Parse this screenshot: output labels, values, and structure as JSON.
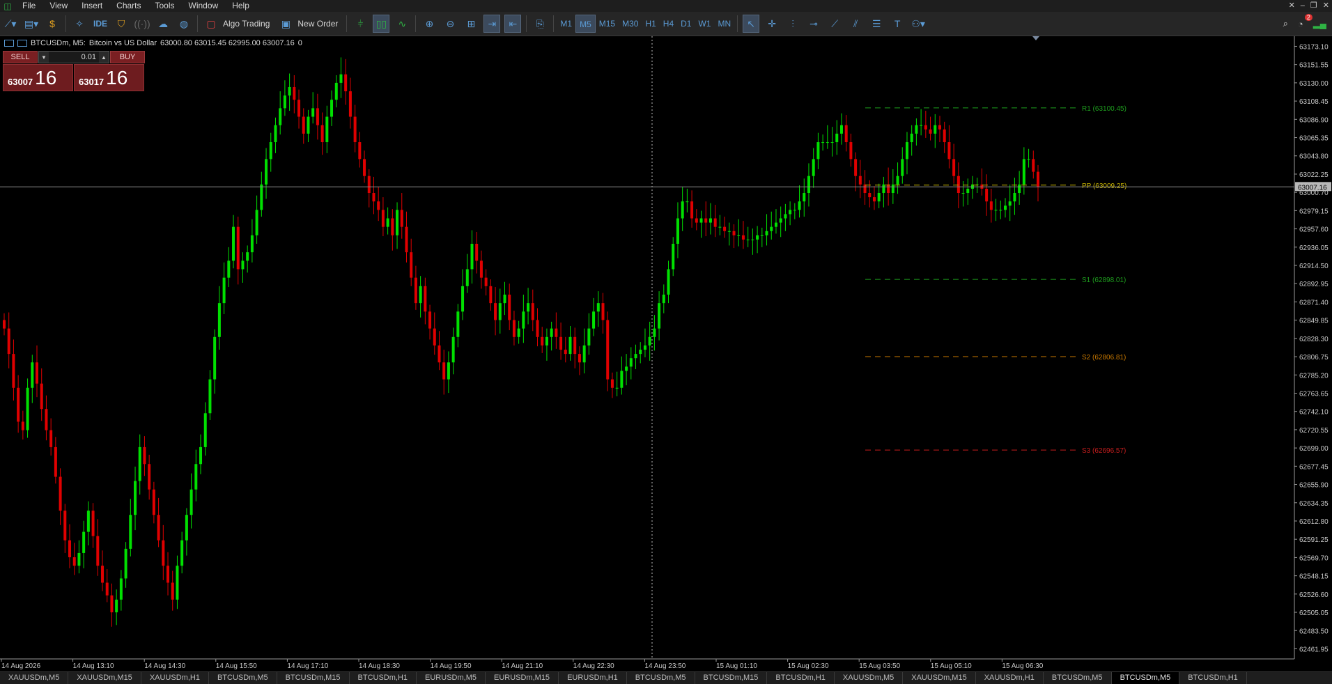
{
  "menu": {
    "items": [
      "File",
      "View",
      "Insert",
      "Charts",
      "Tools",
      "Window",
      "Help"
    ]
  },
  "toolbar": {
    "ide_label": "IDE",
    "algo_trading_label": "Algo Trading",
    "new_order_label": "New Order",
    "timeframes": [
      "M1",
      "M5",
      "M15",
      "M30",
      "H1",
      "H4",
      "D1",
      "W1",
      "MN"
    ],
    "active_timeframe": "M5",
    "notification_count": "2"
  },
  "chart_header": {
    "symbol": "BTCUSDm, M5:",
    "description": "Bitcoin vs US Dollar",
    "ohlc": "63000.80 63015.45 62995.00 63007.16",
    "volume": "0"
  },
  "trade_panel": {
    "sell_label": "SELL",
    "buy_label": "BUY",
    "lot": "0.01",
    "sell_small": "63007",
    "sell_big": "16",
    "buy_small": "63017",
    "buy_big": "16"
  },
  "chart_data": {
    "type": "candlestick",
    "symbol": "BTCUSDm",
    "timeframe": "M5",
    "ylim": [
      62450,
      63185
    ],
    "price_ticks": [
      "63173.10",
      "63151.55",
      "63130.00",
      "63108.45",
      "63086.90",
      "63065.35",
      "63043.80",
      "63022.25",
      "63000.70",
      "62979.15",
      "62957.60",
      "62936.05",
      "62914.50",
      "62892.95",
      "62871.40",
      "62849.85",
      "62828.30",
      "62806.75",
      "62785.20",
      "62763.65",
      "62742.10",
      "62720.55",
      "62699.00",
      "62677.45",
      "62655.90",
      "62634.35",
      "62612.80",
      "62591.25",
      "62569.70",
      "62548.15",
      "62526.60",
      "62505.05",
      "62483.50",
      "62461.95"
    ],
    "time_ticks": [
      "14 Aug 2026",
      "14 Aug 13:10",
      "14 Aug 14:30",
      "14 Aug 15:50",
      "14 Aug 17:10",
      "14 Aug 18:30",
      "14 Aug 19:50",
      "14 Aug 21:10",
      "14 Aug 22:30",
      "14 Aug 23:50",
      "15 Aug 01:10",
      "15 Aug 02:30",
      "15 Aug 03:50",
      "15 Aug 05:10",
      "15 Aug 06:30"
    ],
    "current_price": 63007.16,
    "current_price_label": "63007.16",
    "crosshair_time_label": "14 Aug 23:50",
    "close_series": [
      62840,
      62810,
      62770,
      62730,
      62720,
      62770,
      62800,
      62775,
      62745,
      62720,
      62700,
      62665,
      62625,
      62590,
      62570,
      62560,
      62575,
      62600,
      62625,
      62595,
      62560,
      62540,
      62525,
      62505,
      62520,
      62545,
      62580,
      62620,
      62660,
      62700,
      62680,
      62650,
      62620,
      62590,
      62560,
      62540,
      62520,
      62560,
      62590,
      62620,
      62650,
      62680,
      62700,
      62740,
      62780,
      62830,
      62870,
      62900,
      62920,
      62960,
      62910,
      62920,
      62930,
      62950,
      62980,
      63010,
      63040,
      63060,
      63080,
      63100,
      63115,
      63125,
      63110,
      63090,
      63070,
      63090,
      63100,
      63080,
      63060,
      63090,
      63110,
      63130,
      63140,
      63120,
      63090,
      63060,
      63040,
      63020,
      63000,
      62990,
      62980,
      62960,
      62970,
      62950,
      62980,
      62960,
      62930,
      62900,
      62870,
      62890,
      62860,
      62840,
      62820,
      62800,
      62780,
      62800,
      62830,
      62860,
      62890,
      62910,
      62940,
      62920,
      62900,
      62890,
      62870,
      62850,
      62870,
      62880,
      62850,
      62830,
      62840,
      62860,
      62870,
      62850,
      62830,
      62820,
      62830,
      62840,
      62830,
      62815,
      62810,
      62830,
      62810,
      62800,
      62820,
      62840,
      62860,
      62870,
      62850,
      62780,
      62770,
      62770,
      62790,
      62795,
      62805,
      62810,
      62815,
      62820,
      62830,
      62840,
      62870,
      62880,
      62910,
      62940,
      62970,
      62990,
      62990,
      62970,
      62965,
      62970,
      62965,
      62970,
      62960,
      62960,
      62955,
      62955,
      62950,
      62950,
      62945,
      62945,
      62945,
      62950,
      62950,
      62955,
      62960,
      62965,
      62970,
      62975,
      62980,
      62980,
      62990,
      63000,
      63020,
      63040,
      63060,
      63060,
      63060,
      63060,
      63070,
      63080,
      63060,
      63040,
      63020,
      63010,
      63000,
      62995,
      62990,
      63000,
      63010,
      63000,
      63010,
      63020,
      63040,
      63060,
      63070,
      63080,
      63080,
      63075,
      63070,
      63080,
      63075,
      63060,
      63040,
      63020,
      63000,
      63000,
      63005,
      63010,
      63010,
      63005,
      62990,
      62980,
      62980,
      62980,
      62985,
      62990,
      63000,
      63010,
      63040,
      63040,
      63025,
      63007
    ]
  },
  "pivots": [
    {
      "label": "R1 (63100.45)",
      "value": 63100.45,
      "color": "#1e9e1e"
    },
    {
      "label": "PP (63009.25)",
      "value": 63009.25,
      "color": "#c8b400"
    },
    {
      "label": "S1 (62898.01)",
      "value": 62898.01,
      "color": "#1e9e1e"
    },
    {
      "label": "S2 (62806.81)",
      "value": 62806.81,
      "color": "#c87800"
    },
    {
      "label": "S3 (62696.57)",
      "value": 62696.57,
      "color": "#c81e1e"
    }
  ],
  "colors": {
    "bull": "#00e000",
    "bear": "#e00000",
    "axis_text": "#c8c8c8",
    "price_label_bg": "#b8b8b8"
  },
  "tabs": [
    "XAUUSDm,M5",
    "XAUUSDm,M15",
    "XAUUSDm,H1",
    "BTCUSDm,M5",
    "BTCUSDm,M15",
    "BTCUSDm,H1",
    "EURUSDm,M5",
    "EURUSDm,M15",
    "EURUSDm,H1",
    "BTCUSDm,M5",
    "BTCUSDm,M15",
    "BTCUSDm,H1",
    "XAUUSDm,M5",
    "XAUUSDm,M15",
    "XAUUSDm,H1",
    "BTCUSDm,M5",
    "BTCUSDm,M5",
    "BTCUSDm,H1"
  ],
  "active_tab_index": 16
}
